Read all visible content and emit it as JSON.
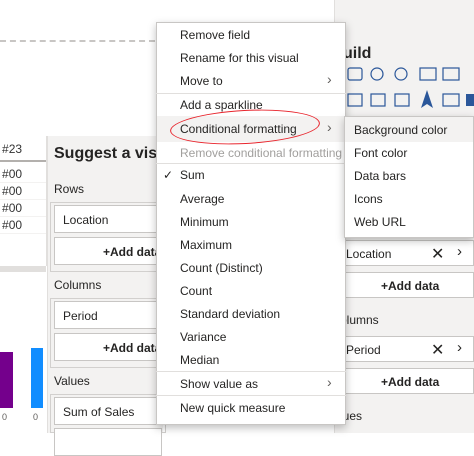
{
  "table": {
    "header": "23",
    "cells": [
      "00",
      "00",
      "00",
      "00"
    ]
  },
  "chart": {
    "tick_labels": [
      "0",
      "0"
    ]
  },
  "suggest_pane": {
    "title": "Suggest a visu",
    "rows_label": "Rows",
    "rows_field": "Location",
    "add_data": "+Add data",
    "columns_label": "Columns",
    "columns_field": "Period",
    "values_label": "Values",
    "values_field": "Sum of Sales"
  },
  "build_pane": {
    "title": "uild",
    "location_field": "Location",
    "add_data": "+Add data",
    "columns_section": "olumns",
    "period_field": "Period",
    "values_section": "lues"
  },
  "context_menu": {
    "items": [
      {
        "label": "Remove field"
      },
      {
        "label": "Rename for this visual"
      },
      {
        "label": "Move to"
      },
      {
        "label": "Add a sparkline"
      },
      {
        "label": "Conditional formatting"
      },
      {
        "label": "Remove conditional formatting"
      },
      {
        "label": "Sum"
      },
      {
        "label": "Average"
      },
      {
        "label": "Minimum"
      },
      {
        "label": "Maximum"
      },
      {
        "label": "Count (Distinct)"
      },
      {
        "label": "Count"
      },
      {
        "label": "Standard deviation"
      },
      {
        "label": "Variance"
      },
      {
        "label": "Median"
      },
      {
        "label": "Show value as"
      },
      {
        "label": "New quick measure"
      }
    ],
    "checked_item": "Sum"
  },
  "submenu": {
    "items": [
      {
        "label": "Background color"
      },
      {
        "label": "Font color"
      },
      {
        "label": "Data bars"
      },
      {
        "label": "Icons"
      },
      {
        "label": "Web URL"
      }
    ]
  },
  "colors": {
    "accent_purple": "#74008c",
    "accent_blue": "#118dff",
    "annotation_red": "#e8252d"
  }
}
